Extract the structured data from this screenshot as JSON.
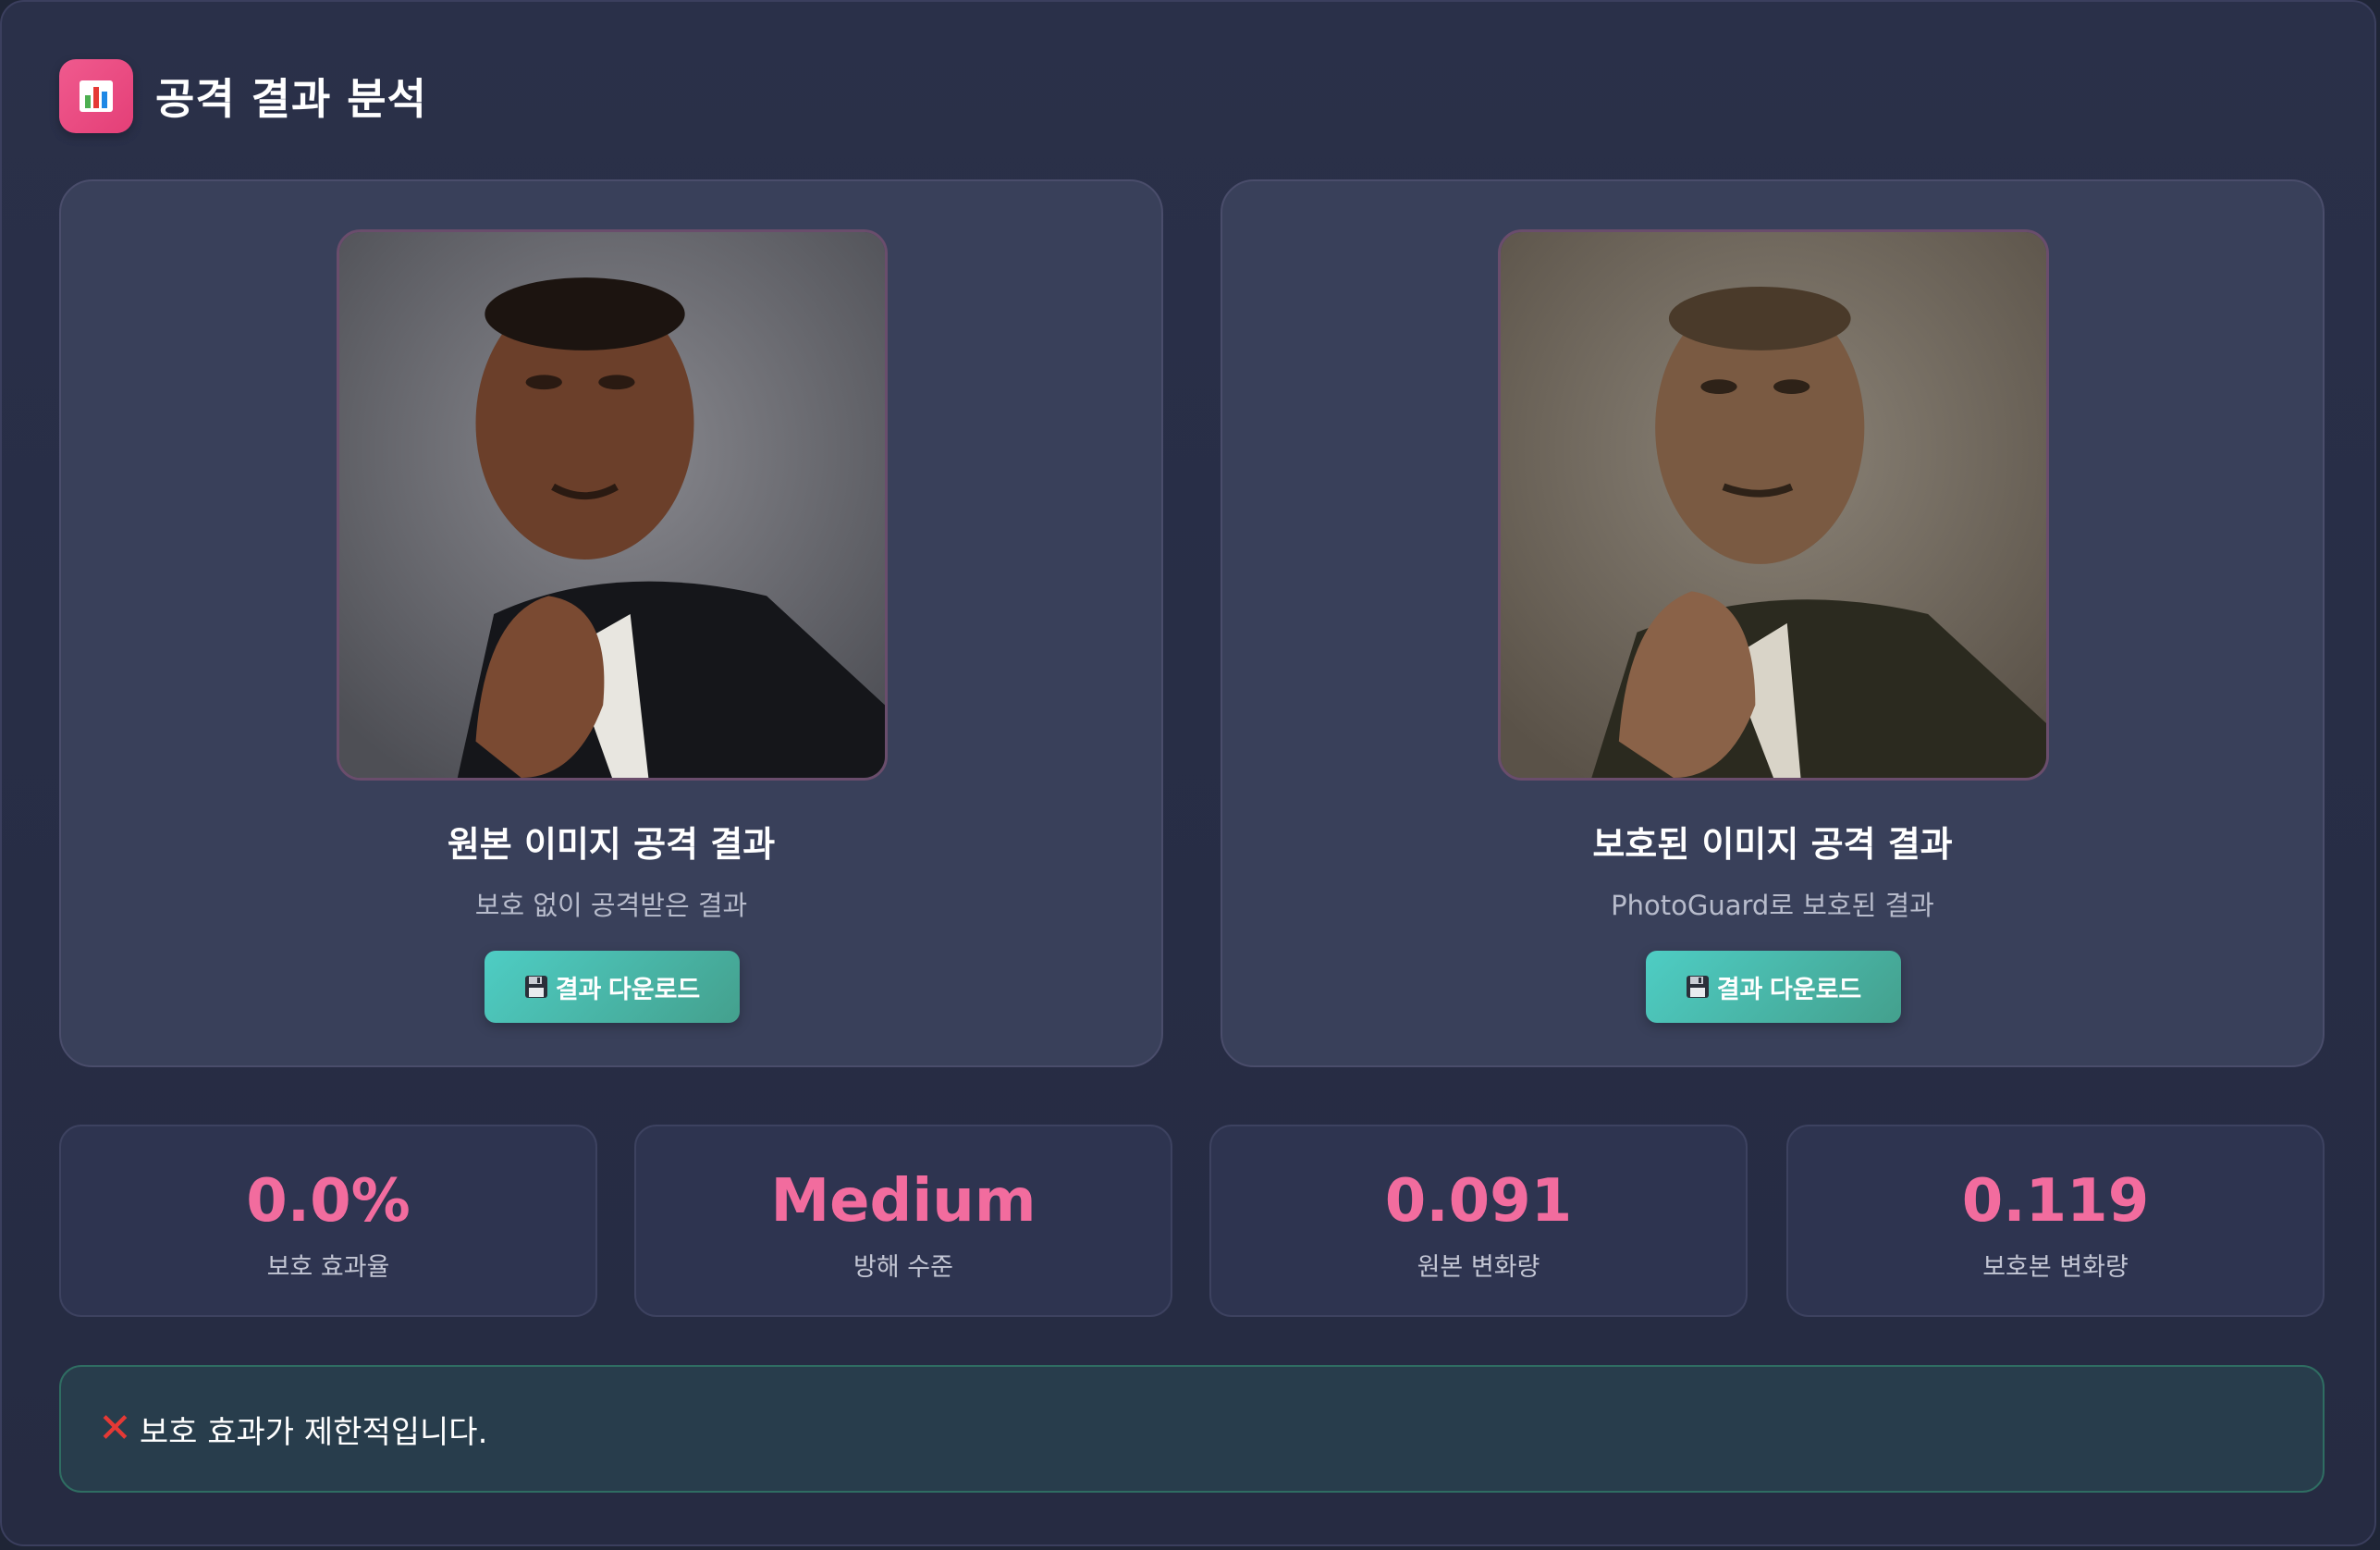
{
  "header": {
    "title": "공격 결과 분석",
    "icon": "bar-chart-icon"
  },
  "cards": [
    {
      "title": "원본 이미지 공격 결과",
      "subtitle": "보호 없이 공격받은 결과",
      "button_label": "결과 다운로드",
      "image": "portrait-original-attacked"
    },
    {
      "title": "보호된 이미지 공격 결과",
      "subtitle": "PhotoGuard로 보호된 결과",
      "button_label": "결과 다운로드",
      "image": "portrait-protected-attacked"
    }
  ],
  "metrics": [
    {
      "value": "0.0%",
      "label": "보호 효과율"
    },
    {
      "value": "Medium",
      "label": "방해 수준"
    },
    {
      "value": "0.091",
      "label": "원본 변화량"
    },
    {
      "value": "0.119",
      "label": "보호본 변화량"
    }
  ],
  "status": {
    "icon": "cross-mark-icon",
    "text": "보호 효과가 제한적입니다."
  },
  "colors": {
    "accent": "#f26c9e",
    "button": "#4ecdc4",
    "background": "#262b42",
    "error": "#e53935"
  }
}
